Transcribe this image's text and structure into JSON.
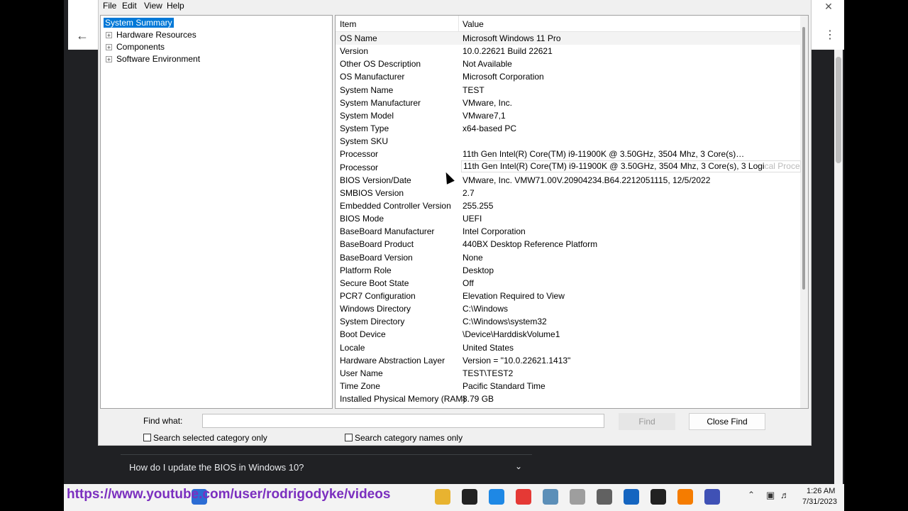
{
  "menu": [
    "File",
    "Edit",
    "View",
    "Help"
  ],
  "tree": {
    "selected": "System Summary",
    "items": [
      "Hardware Resources",
      "Components",
      "Software Environment"
    ]
  },
  "columns": {
    "item": "Item",
    "value": "Value"
  },
  "rows": [
    {
      "item": "OS Name",
      "value": "Microsoft Windows 11 Pro"
    },
    {
      "item": "Version",
      "value": "10.0.22621 Build 22621"
    },
    {
      "item": "Other OS Description",
      "value": "Not Available"
    },
    {
      "item": "OS Manufacturer",
      "value": "Microsoft Corporation"
    },
    {
      "item": "System Name",
      "value": "TEST"
    },
    {
      "item": "System Manufacturer",
      "value": "VMware, Inc."
    },
    {
      "item": "System Model",
      "value": "VMware7,1"
    },
    {
      "item": "System Type",
      "value": "x64-based PC"
    },
    {
      "item": "System SKU",
      "value": ""
    },
    {
      "item": "Processor",
      "value": "11th Gen Intel(R) Core(TM) i9-11900K @ 3.50GHz, 3504 Mhz, 3 Core(s), 3 Logi..."
    },
    {
      "item": "Processor",
      "value": ""
    },
    {
      "item": "BIOS Version/Date",
      "value": "VMware, Inc. VMW71.00V.20904234.B64.2212051115, 12/5/2022"
    },
    {
      "item": "SMBIOS Version",
      "value": "2.7"
    },
    {
      "item": "Embedded Controller Version",
      "value": "255.255"
    },
    {
      "item": "BIOS Mode",
      "value": "UEFI"
    },
    {
      "item": "BaseBoard Manufacturer",
      "value": "Intel Corporation"
    },
    {
      "item": "BaseBoard Product",
      "value": "440BX Desktop Reference Platform"
    },
    {
      "item": "BaseBoard Version",
      "value": "None"
    },
    {
      "item": "Platform Role",
      "value": "Desktop"
    },
    {
      "item": "Secure Boot State",
      "value": "Off"
    },
    {
      "item": "PCR7 Configuration",
      "value": "Elevation Required to View"
    },
    {
      "item": "Windows Directory",
      "value": "C:\\Windows"
    },
    {
      "item": "System Directory",
      "value": "C:\\Windows\\system32"
    },
    {
      "item": "Boot Device",
      "value": "\\Device\\HarddiskVolume1"
    },
    {
      "item": "Locale",
      "value": "United States"
    },
    {
      "item": "Hardware Abstraction Layer",
      "value": "Version = \"10.0.22621.1413\""
    },
    {
      "item": "User Name",
      "value": "TEST\\TEST2"
    },
    {
      "item": "Time Zone",
      "value": "Pacific Standard Time"
    },
    {
      "item": "Installed Physical Memory (RAM)",
      "value": "8.79 GB"
    }
  ],
  "tooltip": {
    "text": "11th Gen Intel(R) Core(TM) i9-11900K @ 3.50GHz, 3504 Mhz, 3 Core(s), 3 Logi",
    "fade": "cal Processor(s)"
  },
  "find": {
    "label": "Find what:",
    "value": "",
    "find_button": "Find",
    "close_button": "Close Find",
    "check_selected": "Search selected category only",
    "check_names": "Search category names only"
  },
  "browser": {
    "faq": "How do I update the BIOS in Windows 10?"
  },
  "overlay_url": "https://www.youtube.com/user/rodrigodyke/videos",
  "clock": {
    "time": "1:26 AM",
    "date": "7/31/2023"
  },
  "taskbar_icons": [
    {
      "name": "start-icon",
      "color": "#2b6cd4"
    },
    {
      "name": "file-explorer-icon",
      "color": "#e8b330"
    },
    {
      "name": "media-player-icon",
      "color": "#222222"
    },
    {
      "name": "whiteboard-icon",
      "color": "#1e88e5"
    },
    {
      "name": "chrome-icon",
      "color": "#e53935"
    },
    {
      "name": "photos-icon",
      "color": "#5c8fb8"
    },
    {
      "name": "notepad-icon",
      "color": "#9e9e9e"
    },
    {
      "name": "settings-icon",
      "color": "#616161"
    },
    {
      "name": "security-icon",
      "color": "#1565c0"
    },
    {
      "name": "terminal-icon",
      "color": "#212121"
    },
    {
      "name": "app-icon",
      "color": "#f57c00"
    },
    {
      "name": "system-info-icon",
      "color": "#3f51b5"
    }
  ]
}
